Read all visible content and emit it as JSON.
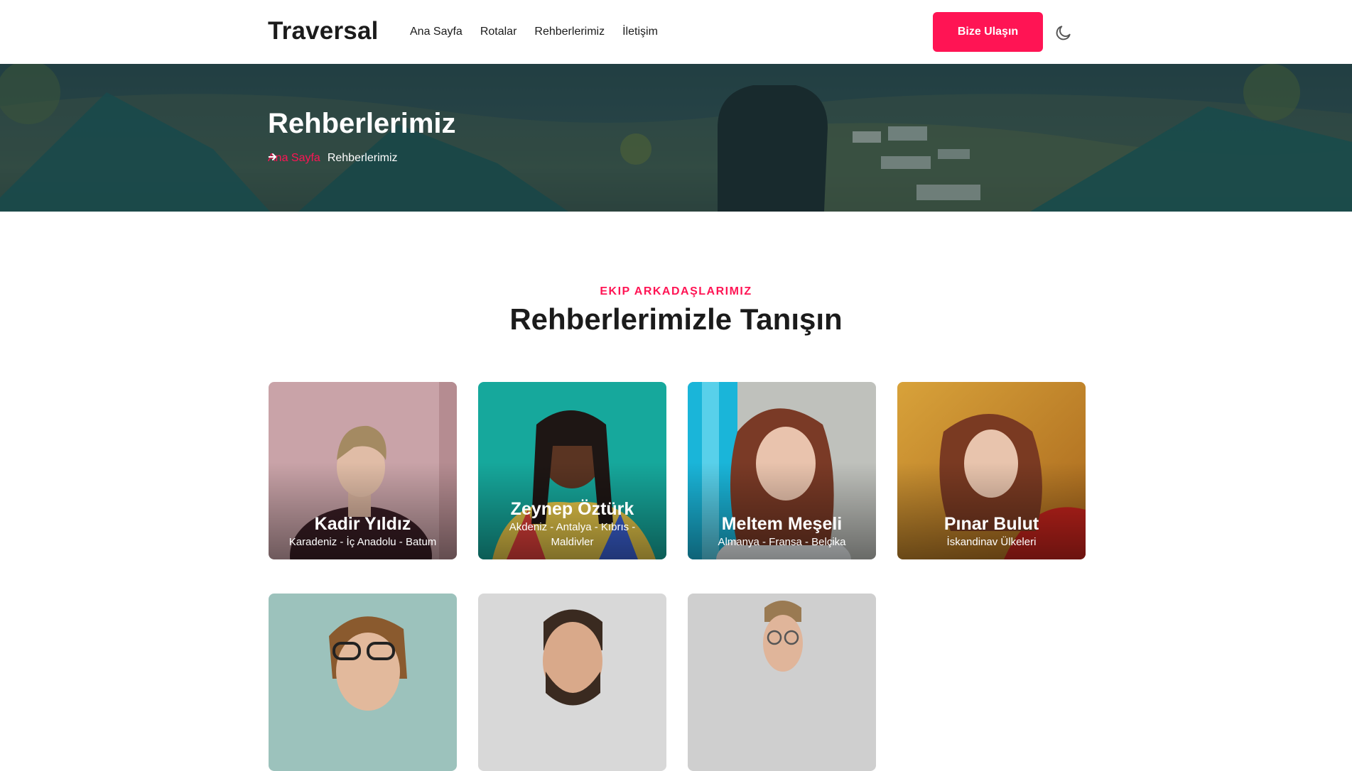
{
  "brand": {
    "logo": "Traversal",
    "accent": "#ff1454"
  },
  "nav": {
    "items": [
      "Ana Sayfa",
      "Rotalar",
      "Rehberlerimiz",
      "İletişim"
    ]
  },
  "header": {
    "cta_label": "Bize Ulaşın",
    "theme_icon": "moon-icon"
  },
  "hero": {
    "title": "Rehberlerimiz",
    "breadcrumb": {
      "home": "Ana Sayfa",
      "current": "Rehberlerimiz",
      "separator_icon": "arrow-right-icon"
    }
  },
  "section": {
    "tag": "EKIP ARKADAŞLARIMIZ",
    "title": "Rehberlerimizle Tanışın"
  },
  "guides": [
    {
      "name": "Kadir Yıldız",
      "regions": "Karadeniz - İç Anadolu - Batum"
    },
    {
      "name": "Zeynep Öztürk",
      "regions": "Akdeniz - Antalya - Kıbrıs - Maldivler"
    },
    {
      "name": "Meltem Meşeli",
      "regions": "Almanya - Fransa - Belçika"
    },
    {
      "name": "Pınar Bulut",
      "regions": "İskandinav Ülkeleri"
    },
    {
      "name": "",
      "regions": ""
    },
    {
      "name": "",
      "regions": ""
    },
    {
      "name": "",
      "regions": ""
    }
  ]
}
